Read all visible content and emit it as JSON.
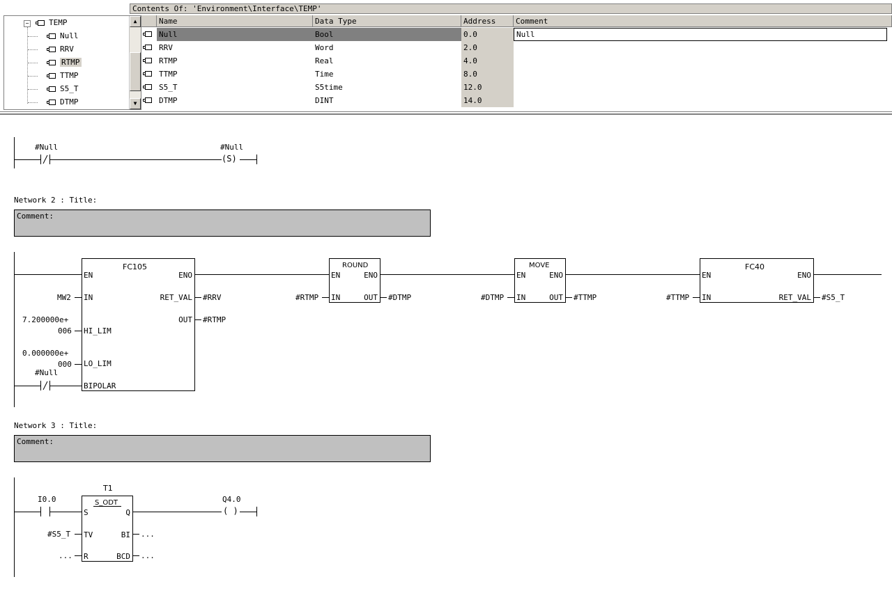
{
  "header": {
    "contents_of": "Contents Of: 'Environment\\Interface\\TEMP'"
  },
  "tree": {
    "root": "TEMP",
    "items": [
      "Null",
      "RRV",
      "RTMP",
      "TTMP",
      "S5_T",
      "DTMP"
    ],
    "selected": "RTMP"
  },
  "grid": {
    "columns": [
      "Name",
      "Data Type",
      "Address",
      "Comment"
    ],
    "rows": [
      {
        "name": "Null",
        "type": "Bool",
        "address": "0.0",
        "comment": "Null"
      },
      {
        "name": "RRV",
        "type": "Word",
        "address": "2.0",
        "comment": ""
      },
      {
        "name": "RTMP",
        "type": "Real",
        "address": "4.0",
        "comment": ""
      },
      {
        "name": "TTMP",
        "type": "Time",
        "address": "8.0",
        "comment": ""
      },
      {
        "name": "S5_T",
        "type": "S5time",
        "address": "12.0",
        "comment": ""
      },
      {
        "name": "DTMP",
        "type": "DINT",
        "address": "14.0",
        "comment": ""
      }
    ]
  },
  "network1": {
    "contact_label": "#Null",
    "coil_label": "#Null",
    "coil_symbol": "(S)"
  },
  "network2": {
    "title": "Network 2 : Title:",
    "comment": "Comment:",
    "fc105": {
      "name": "FC105",
      "en": "EN",
      "eno": "ENO",
      "in": "IN",
      "ret_val": "RET_VAL",
      "out": "OUT",
      "hi_lim": "HI_LIM",
      "lo_lim": "LO_LIM",
      "bipolar": "BIPOLAR",
      "in_val": "MW2",
      "hi_val1": "7.200000e+",
      "hi_val2": "006",
      "lo_val1": "0.000000e+",
      "lo_val2": "000",
      "bipolar_contact": "#Null",
      "ret_out": "#RRV",
      "out_out": "#RTMP"
    },
    "round": {
      "name": "ROUND",
      "en": "EN",
      "eno": "ENO",
      "in": "IN",
      "out": "OUT",
      "in_val": "#RTMP",
      "out_val": "#DTMP"
    },
    "move": {
      "name": "MOVE",
      "en": "EN",
      "eno": "ENO",
      "in": "IN",
      "out": "OUT",
      "in_val": "#DTMP",
      "out_val": "#TTMP"
    },
    "fc40": {
      "name": "FC40",
      "en": "EN",
      "eno": "ENO",
      "in": "IN",
      "ret_val": "RET_VAL",
      "in_val": "#TTMP",
      "out_val": "#S5_T"
    }
  },
  "network3": {
    "title": "Network 3 : Title:",
    "comment": "Comment:",
    "contact_label": "I0.0",
    "timer_name": "T1",
    "timer_type": "S_ODT",
    "s": "S",
    "q": "Q",
    "tv": "TV",
    "bi": "BI",
    "r": "R",
    "bcd": "BCD",
    "tv_val": "#S5_T",
    "bi_val": "...",
    "r_val": "...",
    "bcd_val": "...",
    "coil_label": "Q4.0",
    "coil_symbol": "( )"
  }
}
